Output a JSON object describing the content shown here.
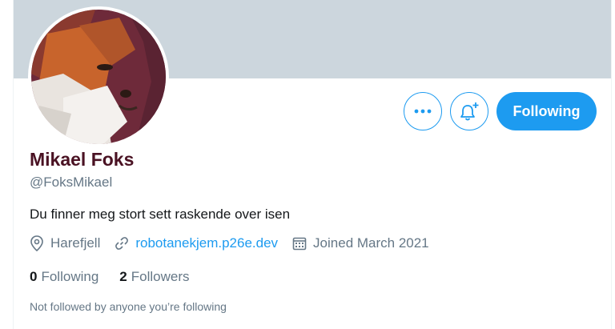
{
  "profile": {
    "name": "Mikael Foks",
    "handle": "@FoksMikael",
    "bio": "Du finner meg stort sett raskende over isen",
    "location": "Harefjell",
    "website": "robotanekjem.p26e.dev",
    "joined": "Joined March 2021"
  },
  "stats": {
    "following_count": "0",
    "following_label": "Following",
    "followers_count": "2",
    "followers_label": "Followers"
  },
  "actions": {
    "follow_label": "Following",
    "more_icon": "more-icon",
    "notify_icon": "bell-plus-icon"
  },
  "note": "Not followed by anyone you’re following",
  "colors": {
    "accent": "#1d9bf0",
    "banner": "#ccd6dd",
    "name": "#4a1223",
    "secondary_text": "#657786"
  }
}
